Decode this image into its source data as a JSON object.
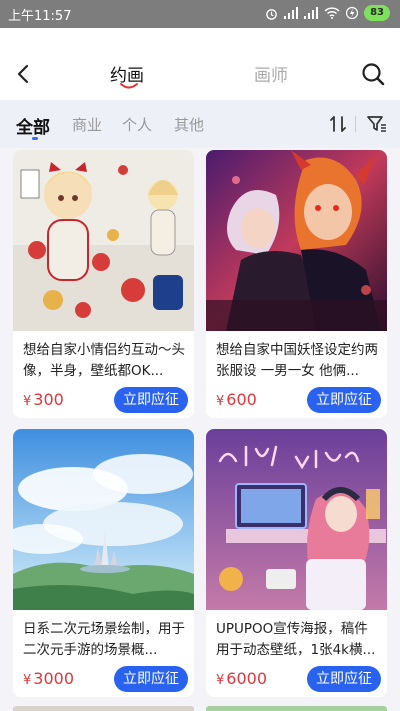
{
  "status_bar": {
    "time": "上午11:57",
    "battery": "83",
    "icons": [
      "alarm-icon",
      "signal-icon",
      "signal-icon",
      "wifi-icon",
      "charging-icon"
    ]
  },
  "header": {
    "tabs": [
      {
        "label": "约画",
        "active": true
      },
      {
        "label": "画师",
        "active": false
      }
    ]
  },
  "filter": {
    "categories": [
      "全部",
      "商业",
      "个人",
      "其他"
    ],
    "active": "全部"
  },
  "cards": [
    {
      "desc": "想给自家小情侣约互动～头像，半身，壁纸都OK...",
      "currency": "¥",
      "price": "300",
      "button": "立即应征",
      "image": "chibi-character-illustration"
    },
    {
      "desc": "想给自家中国妖怪设定约两张服设 一男一女 他俩...",
      "currency": "¥",
      "price": "600",
      "button": "立即应征",
      "image": "demon-couple-illustration"
    },
    {
      "desc": "日系二次元场景绘制，用于二次元手游的场景概...",
      "currency": "¥",
      "price": "3000",
      "button": "立即应征",
      "image": "fantasy-landscape-illustration"
    },
    {
      "desc": "UPUPOO宣传海报，稿件用于动态壁纸，1张4k横...",
      "currency": "¥",
      "price": "6000",
      "button": "立即应征",
      "image": "chill-vibes-room-illustration"
    }
  ],
  "colors": {
    "accent": "#2a62f0",
    "price": "#e0363c",
    "tab_underline": "#e0363c"
  }
}
